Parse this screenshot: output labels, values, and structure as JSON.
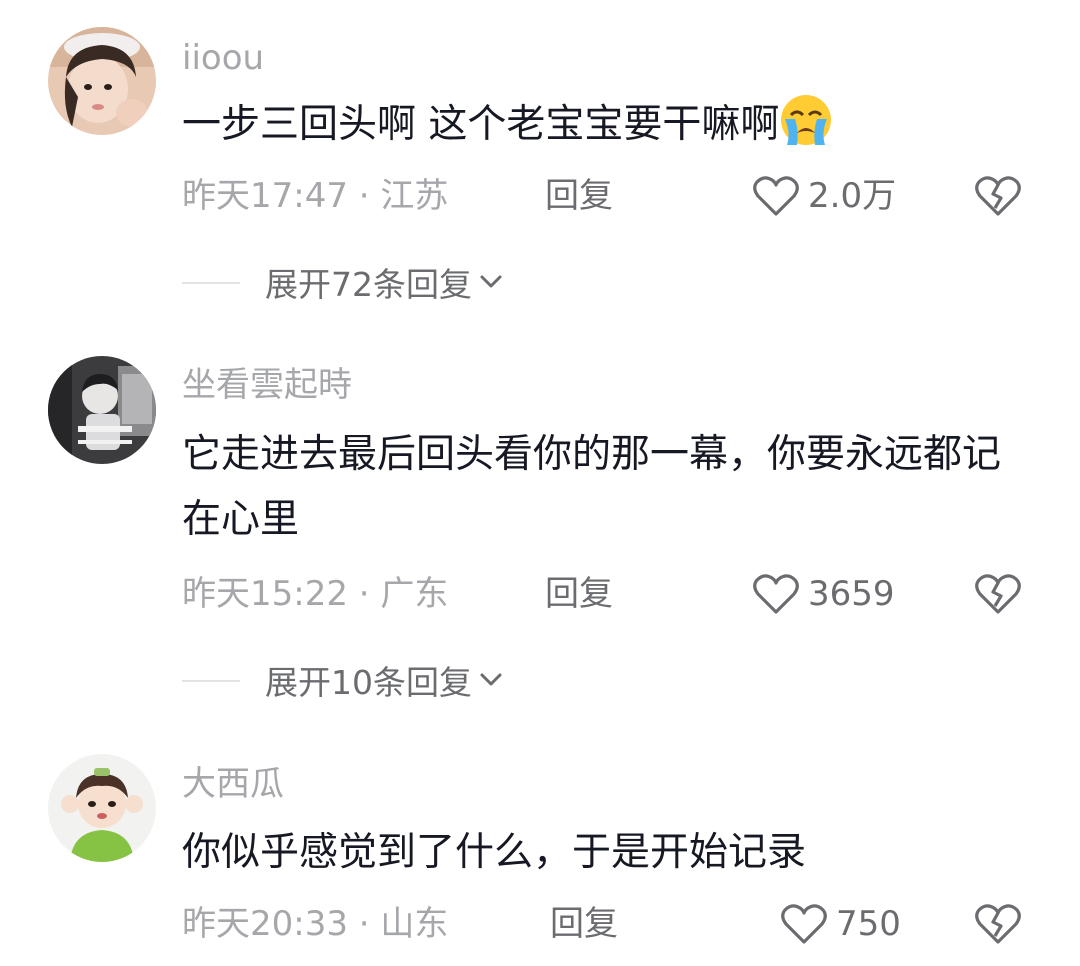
{
  "comments": [
    {
      "username": "iioou",
      "content": "一步三回头啊 这个老宝宝要干嘛啊",
      "time_location": "昨天17:47 · 江苏",
      "reply_label": "回复",
      "like_count": "2.0万",
      "expand_label": "展开72条回复",
      "avatar_icon": "user-avatar-girl",
      "emoji_icon": "loudly-crying-face"
    },
    {
      "username": "坐看雲起時",
      "content": "它走进去最后回头看你的那一幕，你要永远都记在心里",
      "time_location": "昨天15:22 · 广东",
      "reply_label": "回复",
      "like_count": "3659",
      "expand_label": "展开10条回复",
      "avatar_icon": "user-avatar-photo"
    },
    {
      "username": "大西瓜",
      "content": "你似乎感觉到了什么，于是开始记录",
      "time_location": "昨天20:33 · 山东",
      "reply_label": "回复",
      "like_count": "750",
      "avatar_icon": "user-avatar-child"
    }
  ],
  "colors": {
    "text_primary": "#161823",
    "text_secondary": "#a6a7ab",
    "text_action": "#6b6c70",
    "divider": "#e3e3e5"
  }
}
